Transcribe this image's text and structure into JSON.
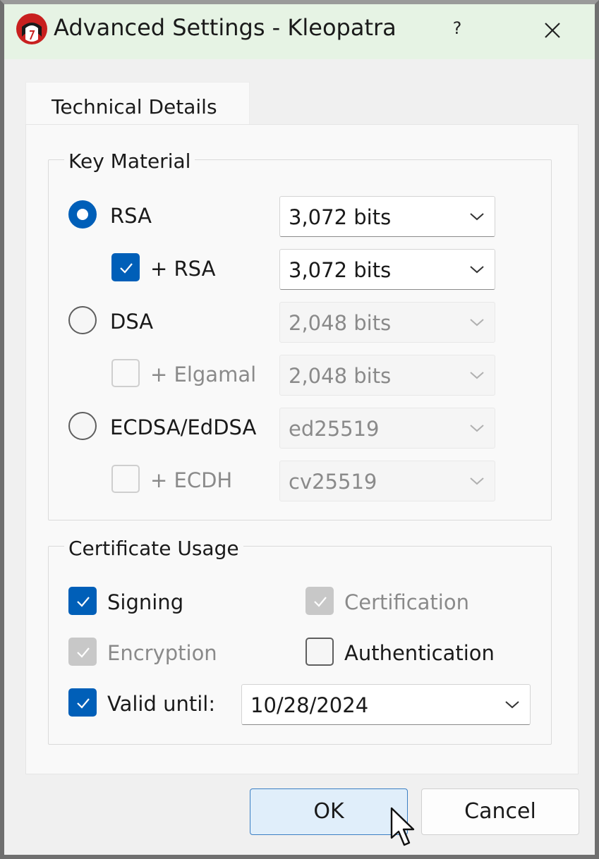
{
  "window": {
    "title": "Advanced Settings - Kleopatra",
    "help_label": "?",
    "icons": {
      "app": "kleopatra-app-icon",
      "close": "close-icon"
    }
  },
  "tabs": [
    {
      "label": "Technical Details",
      "active": true
    }
  ],
  "key_material": {
    "title": "Key Material",
    "options": [
      {
        "kind": "radio",
        "label": "RSA",
        "checked": true,
        "enabled": true,
        "size": "3,072 bits",
        "size_enabled": true
      },
      {
        "kind": "checkbox",
        "label": "+ RSA",
        "checked": true,
        "enabled": true,
        "size": "3,072 bits",
        "size_enabled": true
      },
      {
        "kind": "radio",
        "label": "DSA",
        "checked": false,
        "enabled": true,
        "size": "2,048 bits",
        "size_enabled": false
      },
      {
        "kind": "checkbox",
        "label": "+ Elgamal",
        "checked": false,
        "enabled": false,
        "size": "2,048 bits",
        "size_enabled": false
      },
      {
        "kind": "radio",
        "label": "ECDSA/EdDSA",
        "checked": false,
        "enabled": true,
        "size": "ed25519",
        "size_enabled": false
      },
      {
        "kind": "checkbox",
        "label": "+ ECDH",
        "checked": false,
        "enabled": false,
        "size": "cv25519",
        "size_enabled": false
      }
    ]
  },
  "certificate_usage": {
    "title": "Certificate Usage",
    "signing": {
      "label": "Signing",
      "checked": true,
      "enabled": true
    },
    "certification": {
      "label": "Certification",
      "checked": true,
      "enabled": false
    },
    "encryption": {
      "label": "Encryption",
      "checked": true,
      "enabled": false
    },
    "authentication": {
      "label": "Authentication",
      "checked": false,
      "enabled": true
    },
    "valid_until": {
      "label": "Valid until:",
      "checked": true,
      "enabled": true,
      "date": "10/28/2024"
    }
  },
  "buttons": {
    "ok": "OK",
    "cancel": "Cancel"
  },
  "colors": {
    "accent": "#005fb8",
    "titlebar": "#e6f3e4",
    "app_icon": "#c8201f"
  }
}
